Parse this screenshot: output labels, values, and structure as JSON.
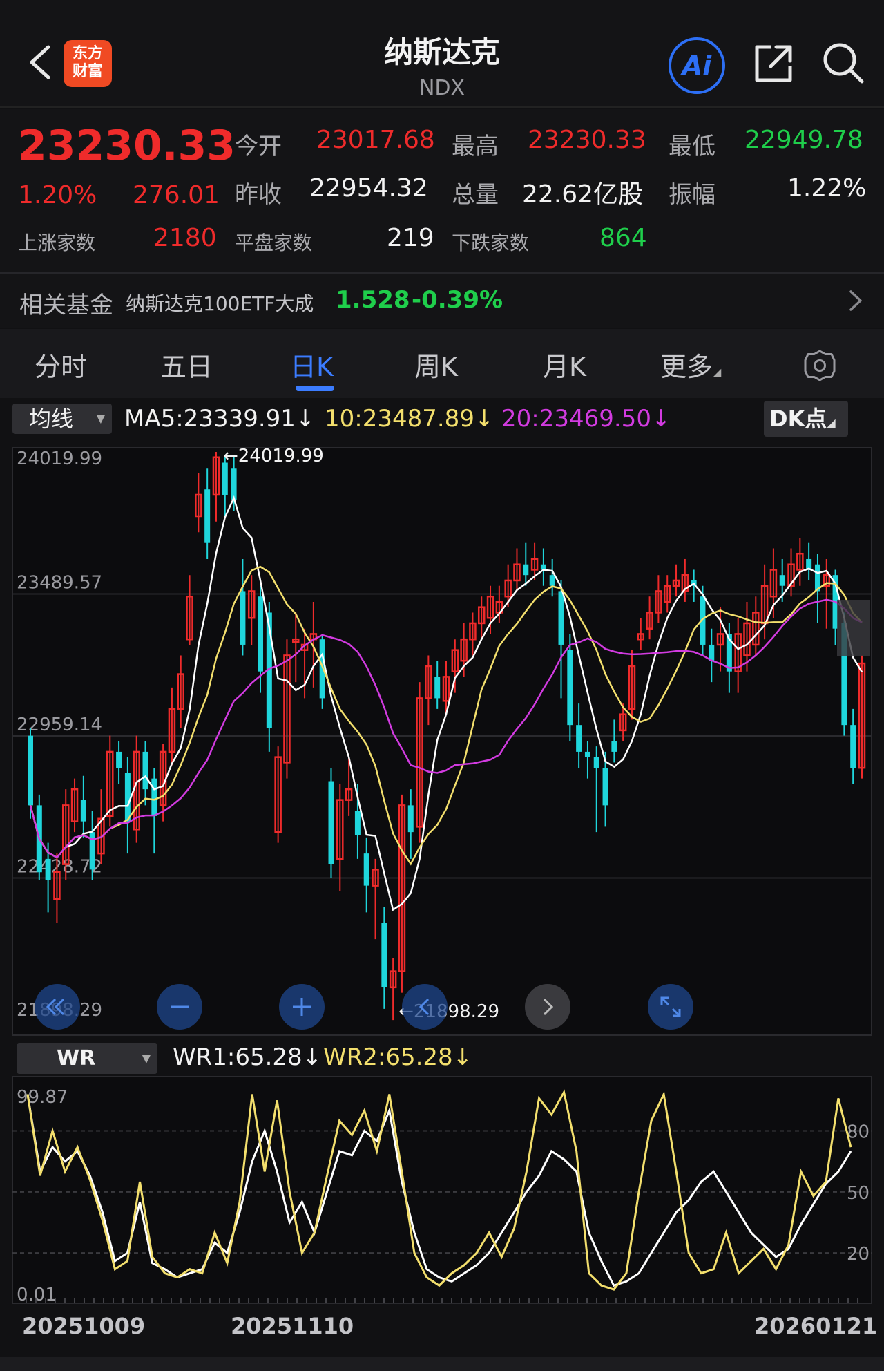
{
  "header": {
    "logo_line1": "东方",
    "logo_line2": "财富",
    "title": "纳斯达克",
    "code": "NDX",
    "ai_label": "Ai"
  },
  "quote": {
    "price": "23230.33",
    "change_pct": "1.20%",
    "change_abs": "276.01",
    "open_label": "今开",
    "open": "23017.68",
    "high_label": "最高",
    "high": "23230.33",
    "low_label": "最低",
    "low": "22949.78",
    "prev_close_label": "昨收",
    "prev_close": "22954.32",
    "volume_label": "总量",
    "volume": "22.62亿股",
    "amplitude_label": "振幅",
    "amplitude": "1.22%",
    "up_label": "上涨家数",
    "up": "2180",
    "flat_label": "平盘家数",
    "flat": "219",
    "down_label": "下跌家数",
    "down": "864",
    "fund_label": "相关基金",
    "fund_name": "纳斯达克100ETF大成",
    "fund_price": "1.528",
    "fund_change": "-0.39%"
  },
  "tabs": [
    {
      "label": "分时"
    },
    {
      "label": "五日"
    },
    {
      "label": "日K"
    },
    {
      "label": "周K"
    },
    {
      "label": "月K"
    },
    {
      "label": "更多"
    }
  ],
  "ma_legend": {
    "selector": "均线",
    "ma5": "MA5:23339.91↓",
    "ma10": "10:23487.89↓",
    "ma20": "20:23469.50↓",
    "dk": "DK点"
  },
  "wr_legend": {
    "selector": "WR",
    "wr1": "WR1:65.28↓",
    "wr2": "WR2:65.28↓"
  },
  "colors": {
    "up": "#ef2b2b",
    "down": "#1fd6dc",
    "ma5": "#ffffff",
    "ma10": "#f3df6d",
    "ma20": "#d23be0",
    "accent": "#3b7cff"
  },
  "chart_data": [
    {
      "type": "candlestick",
      "y_ticks": [
        "24019.99",
        "23489.57",
        "22959.14",
        "22428.72",
        "21898.29"
      ],
      "ylim": [
        21898.29,
        24019.99
      ],
      "annotations": [
        {
          "text": "←24019.99",
          "value": 24019.99
        },
        {
          "text": "←21898.29",
          "value": 21898.29
        }
      ],
      "x_labels": [
        "20251009",
        "20251110",
        "20260121"
      ],
      "candles": [
        [
          22960,
          22700,
          22990,
          22650
        ],
        [
          22700,
          22450,
          22740,
          22420
        ],
        [
          22500,
          22420,
          22560,
          22300
        ],
        [
          22350,
          22450,
          22520,
          22260
        ],
        [
          22480,
          22700,
          22760,
          22420
        ],
        [
          22640,
          22760,
          22800,
          22600
        ],
        [
          22720,
          22640,
          22810,
          22580
        ],
        [
          22600,
          22460,
          22680,
          22420
        ],
        [
          22520,
          22650,
          22760,
          22480
        ],
        [
          22660,
          22900,
          22960,
          22620
        ],
        [
          22900,
          22840,
          22940,
          22780
        ],
        [
          22820,
          22640,
          22880,
          22520
        ],
        [
          22610,
          22900,
          22960,
          22560
        ],
        [
          22900,
          22760,
          22940,
          22700
        ],
        [
          22800,
          22660,
          22840,
          22520
        ],
        [
          22700,
          22900,
          22930,
          22640
        ],
        [
          22900,
          23060,
          23140,
          22850
        ],
        [
          23060,
          23190,
          23260,
          22990
        ],
        [
          23320,
          23480,
          23560,
          23300
        ],
        [
          23780,
          23860,
          23940,
          23720
        ],
        [
          23880,
          23680,
          23960,
          23620
        ],
        [
          23860,
          24000,
          24020,
          23760
        ],
        [
          23980,
          23860,
          24000,
          23780
        ],
        [
          23960,
          23840,
          24000,
          23800
        ],
        [
          23500,
          23300,
          23620,
          23260
        ],
        [
          23400,
          23500,
          23560,
          23300
        ],
        [
          23480,
          23200,
          23520,
          23120
        ],
        [
          23420,
          22990,
          23460,
          22900
        ],
        [
          22600,
          22880,
          22920,
          22560
        ],
        [
          22860,
          23260,
          23320,
          22800
        ],
        [
          23310,
          23320,
          23420,
          23160
        ],
        [
          23280,
          23300,
          23360,
          23100
        ],
        [
          23320,
          23340,
          23460,
          23140
        ],
        [
          23320,
          23100,
          23340,
          23060
        ],
        [
          22790,
          22480,
          22840,
          22430
        ],
        [
          22500,
          22720,
          22780,
          22380
        ],
        [
          22720,
          22760,
          22880,
          22660
        ],
        [
          22680,
          22590,
          22780,
          22500
        ],
        [
          22520,
          22400,
          22580,
          22300
        ],
        [
          22400,
          22460,
          22500,
          22200
        ],
        [
          22260,
          22020,
          22320,
          21940
        ],
        [
          22020,
          22080,
          22130,
          21898
        ],
        [
          22080,
          22700,
          22740,
          22000
        ],
        [
          22700,
          22600,
          22760,
          22500
        ],
        [
          22620,
          23100,
          23160,
          22560
        ],
        [
          23100,
          23220,
          23260,
          23000
        ],
        [
          23180,
          23100,
          23240,
          23060
        ],
        [
          23090,
          23180,
          23240,
          23040
        ],
        [
          23200,
          23280,
          23320,
          23120
        ],
        [
          23240,
          23320,
          23380,
          23180
        ],
        [
          23320,
          23380,
          23420,
          23260
        ],
        [
          23380,
          23440,
          23480,
          23320
        ],
        [
          23400,
          23480,
          23520,
          23340
        ],
        [
          23420,
          23460,
          23520,
          23380
        ],
        [
          23480,
          23540,
          23600,
          23440
        ],
        [
          23540,
          23600,
          23660,
          23500
        ],
        [
          23600,
          23560,
          23680,
          23520
        ],
        [
          23580,
          23620,
          23680,
          23540
        ],
        [
          23600,
          23580,
          23660,
          23520
        ],
        [
          23560,
          23520,
          23620,
          23480
        ],
        [
          23500,
          23300,
          23540,
          23100
        ],
        [
          23280,
          23000,
          23340,
          22940
        ],
        [
          23000,
          22900,
          23080,
          22840
        ],
        [
          22900,
          22880,
          22940,
          22800
        ],
        [
          22880,
          22840,
          22920,
          22600
        ],
        [
          22840,
          22700,
          22900,
          22620
        ],
        [
          22940,
          22900,
          23020,
          22860
        ],
        [
          22980,
          23040,
          23080,
          22940
        ],
        [
          23060,
          23220,
          23280,
          23020
        ],
        [
          23320,
          23340,
          23400,
          23280
        ],
        [
          23360,
          23420,
          23480,
          23320
        ],
        [
          23420,
          23500,
          23560,
          23380
        ],
        [
          23460,
          23520,
          23560,
          23420
        ],
        [
          23520,
          23540,
          23600,
          23480
        ],
        [
          23500,
          23560,
          23620,
          23460
        ],
        [
          23540,
          23520,
          23580,
          23460
        ],
        [
          23480,
          23300,
          23520,
          23260
        ],
        [
          23300,
          23240,
          23360,
          23160
        ],
        [
          23300,
          23340,
          23440,
          23200
        ],
        [
          23340,
          23200,
          23380,
          23120
        ],
        [
          23200,
          23340,
          23400,
          23120
        ],
        [
          23260,
          23380,
          23460,
          23200
        ],
        [
          23300,
          23420,
          23480,
          23260
        ],
        [
          23380,
          23520,
          23600,
          23320
        ],
        [
          23480,
          23580,
          23660,
          23400
        ],
        [
          23560,
          23520,
          23620,
          23460
        ],
        [
          23520,
          23600,
          23660,
          23480
        ],
        [
          23580,
          23640,
          23700,
          23520
        ],
        [
          23620,
          23580,
          23680,
          23540
        ],
        [
          23600,
          23500,
          23640,
          23380
        ],
        [
          23520,
          23560,
          23620,
          23360
        ],
        [
          23560,
          23360,
          23580,
          23300
        ],
        [
          23380,
          23000,
          23420,
          22960
        ],
        [
          23000,
          22840,
          23060,
          22780
        ],
        [
          22840,
          23230,
          23260,
          22800
        ]
      ]
    },
    {
      "type": "line",
      "y_ticks": [
        "99.87",
        "0.01",
        "80",
        "50",
        "20"
      ],
      "ylim": [
        0.01,
        99.87
      ],
      "series": [
        {
          "name": "WR1",
          "values": [
            98,
            60,
            72,
            65,
            70,
            58,
            40,
            16,
            20,
            45,
            15,
            12,
            8,
            10,
            12,
            25,
            20,
            40,
            65,
            80,
            60,
            35,
            45,
            30,
            50,
            70,
            68,
            80,
            75,
            90,
            55,
            30,
            12,
            8,
            6,
            10,
            14,
            20,
            30,
            40,
            50,
            58,
            70,
            66,
            60,
            30,
            16,
            4,
            6,
            10,
            20,
            30,
            40,
            46,
            55,
            60,
            50,
            40,
            30,
            24,
            18,
            22,
            34,
            44,
            54,
            60,
            70
          ]
        },
        {
          "name": "WR2",
          "values": [
            98,
            58,
            80,
            60,
            72,
            56,
            36,
            12,
            16,
            55,
            18,
            10,
            8,
            12,
            10,
            30,
            15,
            45,
            98,
            60,
            95,
            50,
            20,
            30,
            58,
            85,
            78,
            90,
            70,
            98,
            60,
            20,
            8,
            4,
            10,
            14,
            20,
            30,
            18,
            32,
            60,
            96,
            88,
            99,
            70,
            10,
            4,
            2,
            10,
            50,
            85,
            98,
            60,
            20,
            10,
            12,
            30,
            10,
            16,
            22,
            12,
            24,
            60,
            48,
            55,
            96,
            72
          ]
        }
      ]
    }
  ]
}
